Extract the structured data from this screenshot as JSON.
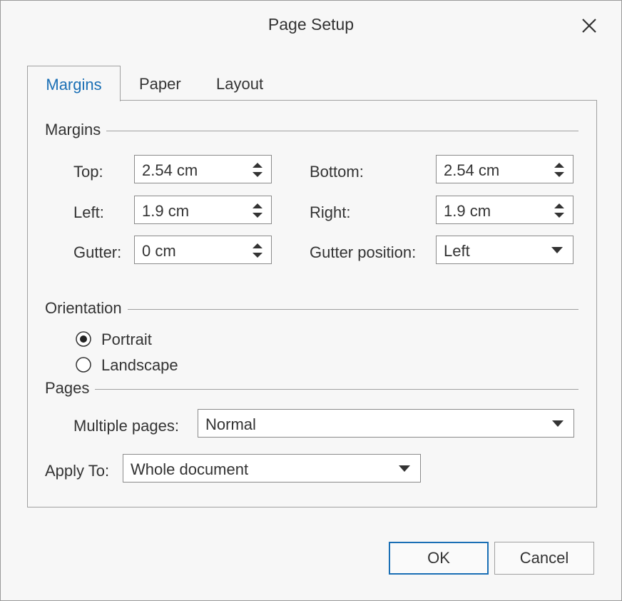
{
  "dialog": {
    "title": "Page Setup"
  },
  "tabs": [
    {
      "label": "Margins",
      "active": true
    },
    {
      "label": "Paper",
      "active": false
    },
    {
      "label": "Layout",
      "active": false
    }
  ],
  "margins": {
    "heading": "Margins",
    "top": {
      "label": "Top:",
      "value": "2.54 cm"
    },
    "bottom": {
      "label": "Bottom:",
      "value": "2.54 cm"
    },
    "left": {
      "label": "Left:",
      "value": "1.9 cm"
    },
    "right": {
      "label": "Right:",
      "value": "1.9 cm"
    },
    "gutter": {
      "label": "Gutter:",
      "value": "0 cm"
    },
    "gutter_position": {
      "label": "Gutter position:",
      "value": "Left"
    }
  },
  "orientation": {
    "heading": "Orientation",
    "portrait": {
      "label": "Portrait",
      "selected": true
    },
    "landscape": {
      "label": "Landscape",
      "selected": false
    }
  },
  "pages": {
    "heading": "Pages",
    "multiple_pages": {
      "label": "Multiple pages:",
      "value": "Normal"
    }
  },
  "apply_to": {
    "label": "Apply To:",
    "value": "Whole document"
  },
  "buttons": {
    "ok": "OK",
    "cancel": "Cancel"
  },
  "colors": {
    "accent": "#1a6fb5",
    "border": "#a0a0a0"
  },
  "icons": [
    "close-icon",
    "spin-updown-icon",
    "chevron-down-icon",
    "radio-icon"
  ]
}
